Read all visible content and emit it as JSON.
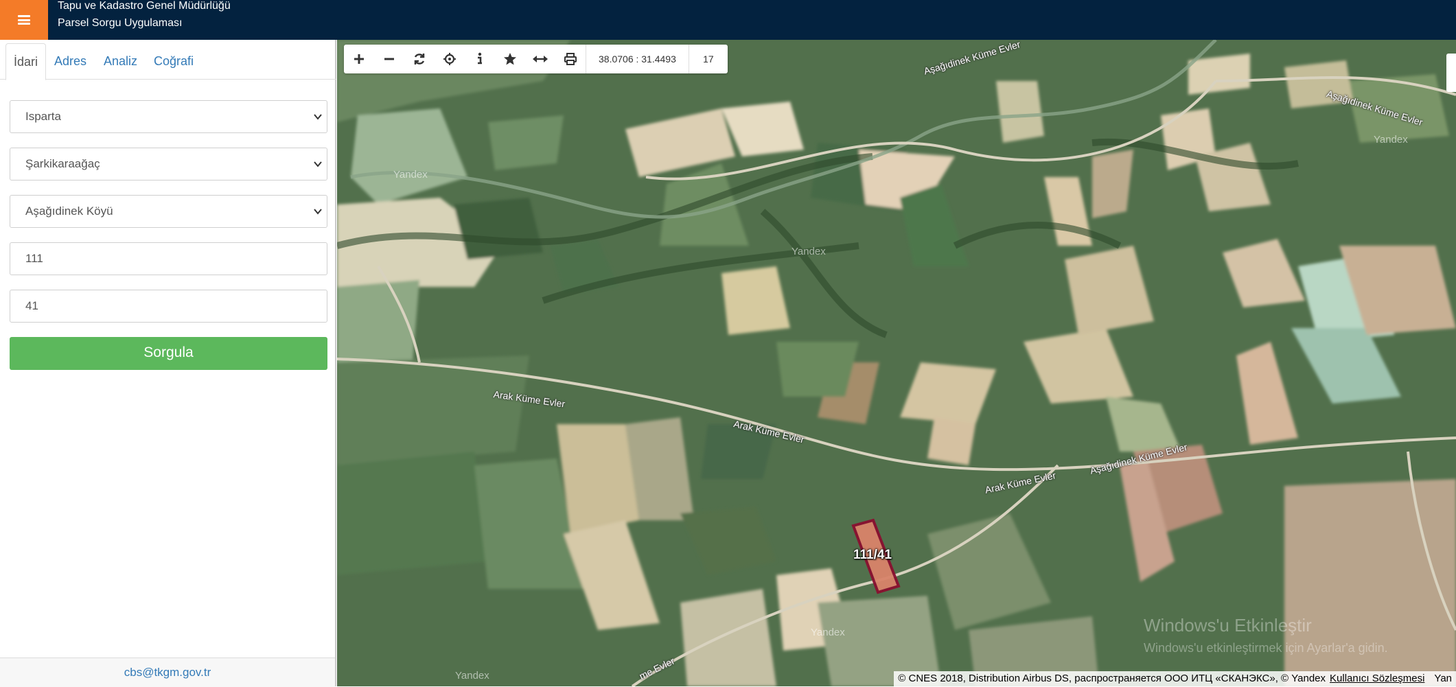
{
  "header": {
    "menu_icon": "hamburger-icon",
    "title_line1": "Tapu ve Kadastro Genel Müdürlüğü",
    "title_line2": "Parsel Sorgu Uygulaması",
    "colors": {
      "bar": "#03223f",
      "menu": "#f47b28"
    }
  },
  "sidebar": {
    "tabs": [
      {
        "label": "İdari",
        "active": true
      },
      {
        "label": "Adres",
        "active": false
      },
      {
        "label": "Analiz",
        "active": false
      },
      {
        "label": "Coğrafi",
        "active": false
      }
    ],
    "province_select": "Isparta",
    "district_select": "Şarkikaraağaç",
    "neighborhood_select": "Aşağıdinek Köyü",
    "block_input": "111",
    "parcel_input": "41",
    "query_button": "Sorgula",
    "footer_email": "cbs@tkgm.gov.tr",
    "colors": {
      "button": "#5cb85c",
      "link": "#337ab7"
    }
  },
  "map": {
    "toolbar": {
      "icons": [
        "zoom-in-icon",
        "zoom-out-icon",
        "refresh-icon",
        "locate-icon",
        "info-icon",
        "favorite-icon",
        "measure-icon",
        "print-icon"
      ],
      "coordinates": "38.0706 : 31.4493",
      "zoom_level": "17"
    },
    "road_labels": {
      "r1": "Aşağıdinek Küme Evler",
      "r2": "Aşağıdinek Küme Evler",
      "r3": "Arak Küme Evler",
      "r4": "Arak Küme Evler",
      "r5": "Arak Küme Evler",
      "r6": "Aşağıdinek Küme Evler",
      "r7": "me Evler"
    },
    "yandex_mark": "Yandex",
    "parcel_label": "111/41",
    "watermark_line1": "Windows'u Etkinleştir",
    "watermark_line2": "Windows'u etkinleştirmek için Ayarlar'a gidin.",
    "attribution": "© CNES 2018, Distribution Airbus DS, распространяется ООО ИТЦ «СКАНЭКС», © Yandex",
    "terms_link": "Kullanıcı Sözleşmesi",
    "attribution_tail": "Yan",
    "colors": {
      "parcel_stroke": "#8a1030",
      "parcel_fill": "#d9846a"
    }
  }
}
